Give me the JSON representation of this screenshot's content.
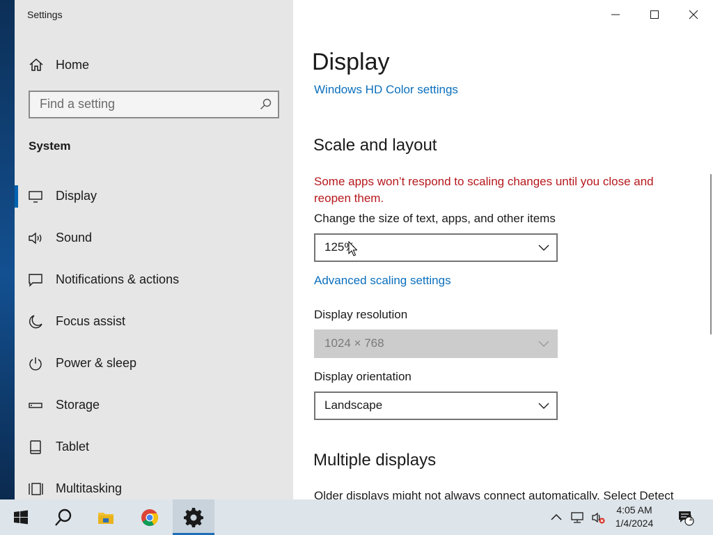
{
  "window": {
    "title": "Settings"
  },
  "sidebar": {
    "home_label": "Home",
    "search_placeholder": "Find a setting",
    "section_title": "System",
    "items": [
      {
        "label": "Display",
        "icon": "monitor-icon",
        "active": true
      },
      {
        "label": "Sound",
        "icon": "speaker-icon"
      },
      {
        "label": "Notifications & actions",
        "icon": "notification-icon"
      },
      {
        "label": "Focus assist",
        "icon": "moon-icon"
      },
      {
        "label": "Power & sleep",
        "icon": "power-icon"
      },
      {
        "label": "Storage",
        "icon": "storage-icon"
      },
      {
        "label": "Tablet",
        "icon": "tablet-icon"
      },
      {
        "label": "Multitasking",
        "icon": "multitasking-icon"
      }
    ]
  },
  "content": {
    "page_title": "Display",
    "hd_color_link": "Windows HD Color settings",
    "scale_heading": "Scale and layout",
    "scale_warning": "Some apps won’t respond to scaling changes until you close and reopen them.",
    "size_label": "Change the size of text, apps, and other items",
    "size_value": "125%",
    "advanced_link": "Advanced scaling settings",
    "resolution_label": "Display resolution",
    "resolution_value": "1024 × 768",
    "orientation_label": "Display orientation",
    "orientation_value": "Landscape",
    "multiple_heading": "Multiple displays",
    "multiple_text": "Older displays might not always connect automatically. Select Detect"
  },
  "taskbar": {
    "apps": [
      "start-icon",
      "search-icon",
      "file-explorer-icon",
      "chrome-icon",
      "settings-gear-icon"
    ],
    "time": "4:05 AM",
    "date": "1/4/2024",
    "notification_count": "1"
  },
  "colors": {
    "accent": "#0063b1",
    "link": "#0a6fbd",
    "warning": "#b6181d",
    "sidebar_bg": "#e6e6e6"
  }
}
